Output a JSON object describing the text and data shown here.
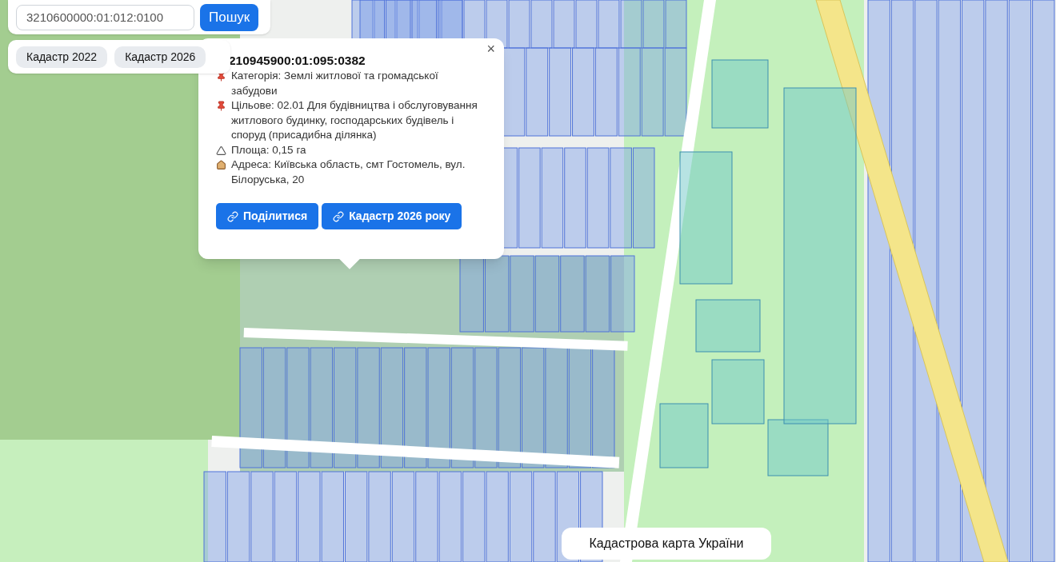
{
  "search": {
    "value": "3210600000:01:012:0100",
    "button": "Пошук"
  },
  "layers": [
    {
      "label": "Кадастр 2022"
    },
    {
      "label": "Кадастр 2026"
    }
  ],
  "popup": {
    "title": "210945900:01:095:0382",
    "close": "×",
    "fields": [
      {
        "kind": "pin",
        "text": "Категорія: Землі житлової та громадської забудови"
      },
      {
        "kind": "pin",
        "text": "Цільове: 02.01 Для будівництва і обслуговування житлового будинку, господарських будівель і споруд (присадибна ділянка)"
      },
      {
        "kind": "area",
        "text": "Площа: 0,15 га"
      },
      {
        "kind": "address",
        "text": "Адреса: Київська область, смт Гостомель, вул. Білоруська, 20"
      }
    ],
    "buttons": [
      "Поділитися",
      "Кадастр 2026 року"
    ]
  },
  "caption": "Кадастрова карта України"
}
